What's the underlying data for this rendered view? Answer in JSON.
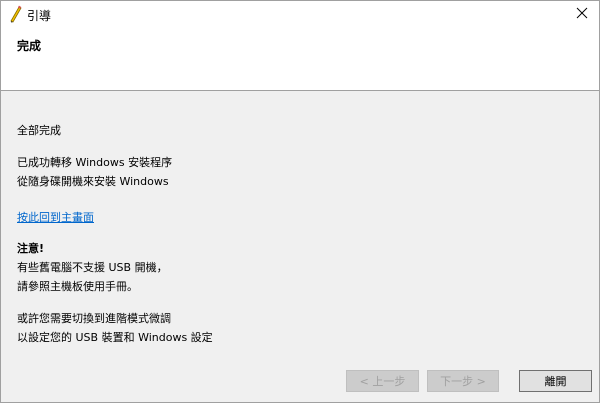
{
  "window": {
    "title": "引導",
    "close_glyph": "✕"
  },
  "header": {
    "title": "完成"
  },
  "content": {
    "done_label": "全部完成",
    "success_line1": "已成功轉移 Windows 安裝程序",
    "success_line2": "從隨身碟開機來安裝 Windows",
    "back_link": "按此回到主畫面",
    "note_title": "注意!",
    "note_line1": "有些舊電腦不支援 USB 開機，",
    "note_line2": "請參照主機板使用手冊。",
    "tip_line1": "或許您需要切換到進階模式微調",
    "tip_line2": "以設定您的 USB 裝置和 Windows 設定"
  },
  "buttons": {
    "prev": "< 上一步",
    "next": "下一步 >",
    "close": "離開"
  },
  "colors": {
    "accent_link": "#0066cc",
    "dialog_bg": "#f0f0f0"
  },
  "icons": {
    "title_icon": "pencil-icon",
    "close_icon": "close-icon"
  }
}
